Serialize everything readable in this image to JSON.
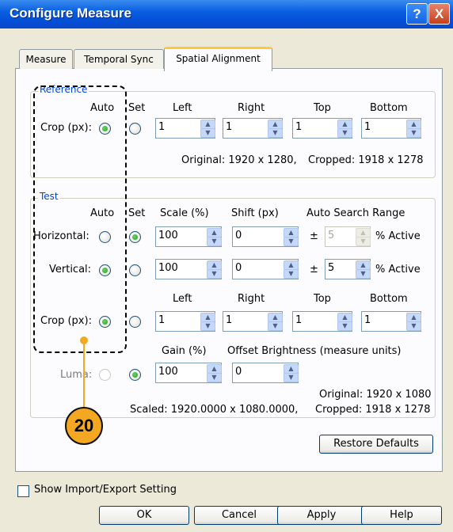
{
  "window": {
    "title": "Configure Measure",
    "help_glyph": "?",
    "close_glyph": "X"
  },
  "tabs": [
    {
      "label": "Measure"
    },
    {
      "label": "Temporal Sync"
    },
    {
      "label": "Spatial Alignment"
    }
  ],
  "reference": {
    "legend": "Reference",
    "headers": {
      "auto": "Auto",
      "set": "Set",
      "left": "Left",
      "right": "Right",
      "top": "Top",
      "bottom": "Bottom"
    },
    "crop_label": "Crop (px):",
    "crop_values": {
      "left": "1",
      "right": "1",
      "top": "1",
      "bottom": "1"
    },
    "original": "Original: 1920 x 1280,",
    "cropped": "Cropped: 1918 x 1278"
  },
  "test": {
    "legend": "Test",
    "headers": {
      "auto": "Auto",
      "set": "Set",
      "scale": "Scale (%)",
      "shift": "Shift (px)",
      "auto_search": "Auto Search Range"
    },
    "horizontal": {
      "label": "Horizontal:",
      "scale": "100",
      "shift": "0",
      "pm": "±",
      "range": "5",
      "active": "% Active"
    },
    "vertical": {
      "label": "Vertical:",
      "scale": "100",
      "shift": "0",
      "pm": "±",
      "range": "5",
      "active": "% Active"
    },
    "crop_headers": {
      "left": "Left",
      "right": "Right",
      "top": "Top",
      "bottom": "Bottom"
    },
    "crop_label": "Crop (px):",
    "crop_values": {
      "left": "1",
      "right": "1",
      "top": "1",
      "bottom": "1"
    },
    "gain_header": "Gain (%)",
    "offset_header": "Offset Brightness (measure units)",
    "luma_label": "Luma:",
    "gain": "100",
    "offset": "0",
    "original": "Original: 1920 x 1080",
    "scaled": "Scaled: 1920.0000 x 1080.0000,",
    "cropped": "Cropped: 1918 x 1278"
  },
  "restore_defaults": "Restore Defaults",
  "show_import_export": "Show Import/Export Setting",
  "buttons": {
    "ok": "OK",
    "cancel": "Cancel",
    "apply": "Apply",
    "help": "Help"
  },
  "callout": {
    "number": "20",
    "color": "#F4A822"
  },
  "arrow_glyphs": {
    "up": "▲",
    "down": "▼"
  }
}
